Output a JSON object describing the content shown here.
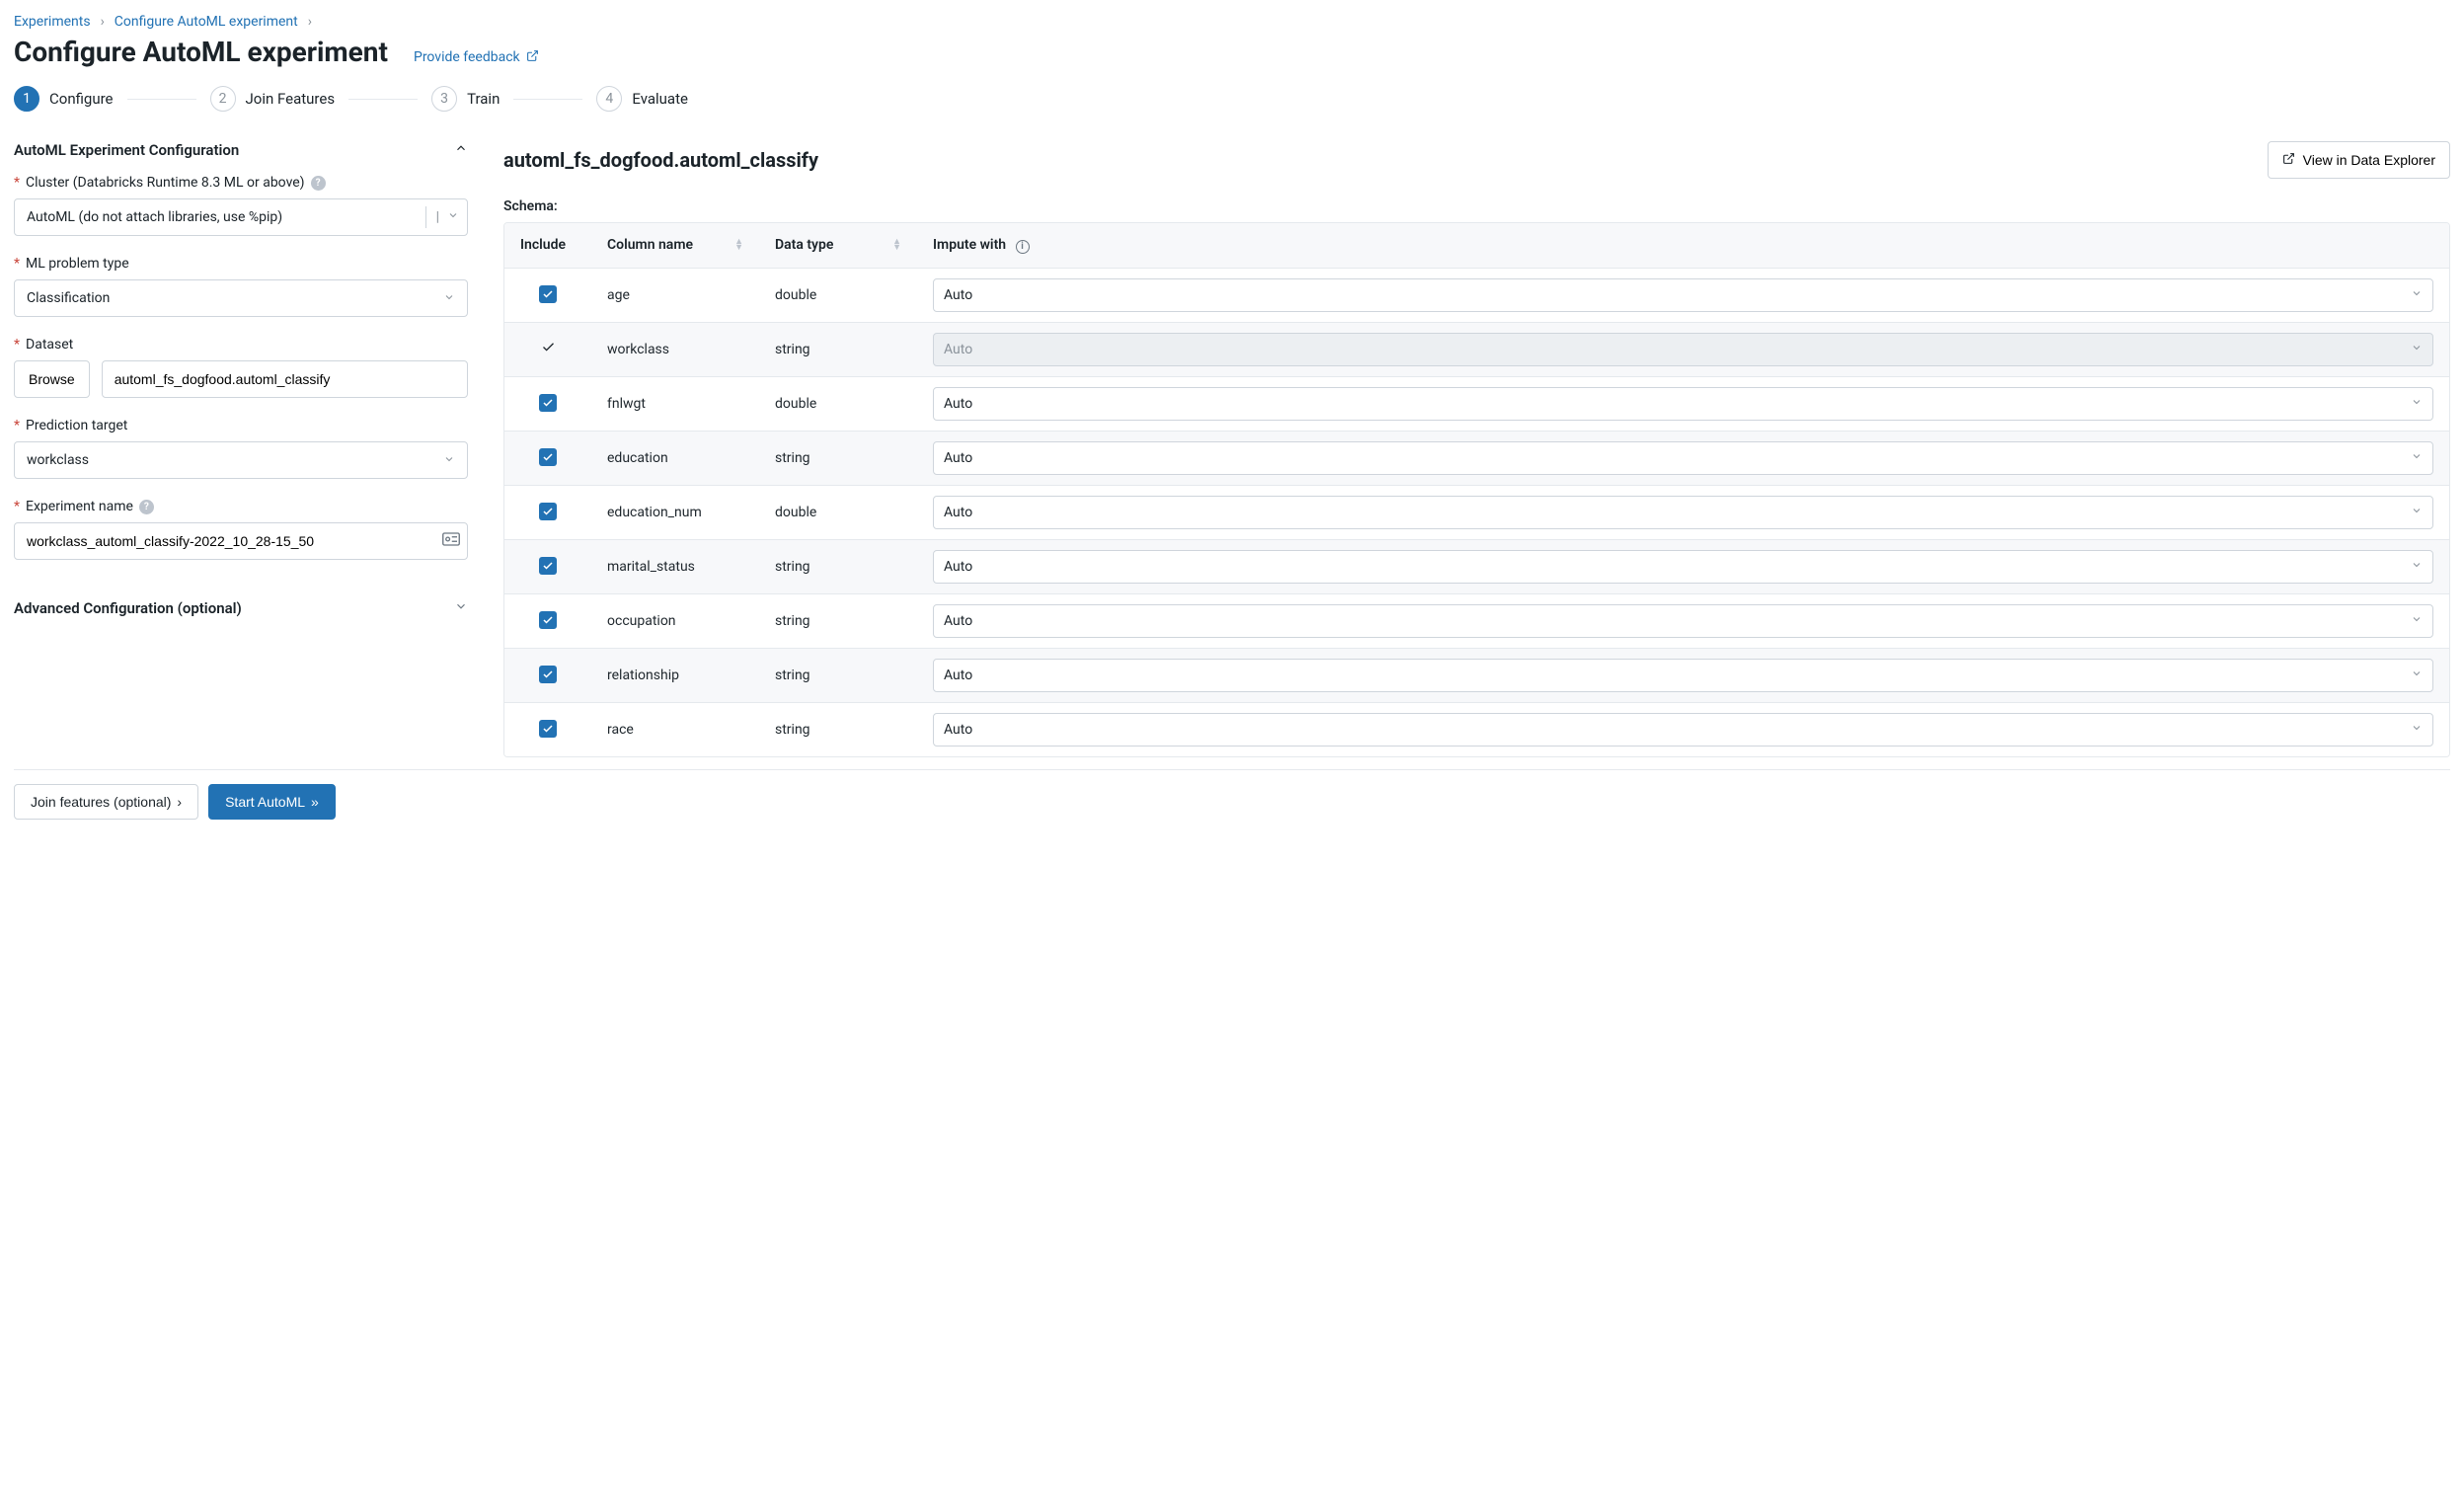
{
  "breadcrumb": {
    "root": "Experiments",
    "current": "Configure AutoML experiment"
  },
  "page_title": "Configure AutoML experiment",
  "feedback_link": "Provide feedback",
  "steps": {
    "s1": "Configure",
    "s2": "Join Features",
    "s3": "Train",
    "s4": "Evaluate"
  },
  "config": {
    "section_title": "AutoML Experiment Configuration",
    "cluster_label": "Cluster (Databricks Runtime 8.3 ML or above)",
    "cluster_value": "AutoML (do not attach libraries, use %pip)",
    "problem_label": "ML problem type",
    "problem_value": "Classification",
    "dataset_label": "Dataset",
    "browse_label": "Browse",
    "dataset_value": "automl_fs_dogfood.automl_classify",
    "target_label": "Prediction target",
    "target_value": "workclass",
    "exp_label": "Experiment name",
    "exp_value": "workclass_automl_classify-2022_10_28-15_50",
    "adv_title": "Advanced Configuration (optional)",
    "auto_option": "Auto"
  },
  "right": {
    "title": "automl_fs_dogfood.automl_classify",
    "explorer_btn": "View in Data Explorer",
    "schema_label": "Schema:"
  },
  "schema_headers": {
    "include": "Include",
    "column": "Column name",
    "type": "Data type",
    "impute": "Impute with"
  },
  "schema_rows": [
    {
      "name": "age",
      "type": "double",
      "included": true,
      "locked": false
    },
    {
      "name": "workclass",
      "type": "string",
      "included": true,
      "locked": true
    },
    {
      "name": "fnlwgt",
      "type": "double",
      "included": true,
      "locked": false
    },
    {
      "name": "education",
      "type": "string",
      "included": true,
      "locked": false
    },
    {
      "name": "education_num",
      "type": "double",
      "included": true,
      "locked": false
    },
    {
      "name": "marital_status",
      "type": "string",
      "included": true,
      "locked": false
    },
    {
      "name": "occupation",
      "type": "string",
      "included": true,
      "locked": false
    },
    {
      "name": "relationship",
      "type": "string",
      "included": true,
      "locked": false
    },
    {
      "name": "race",
      "type": "string",
      "included": true,
      "locked": false
    }
  ],
  "footer": {
    "join_btn": "Join features (optional)",
    "start_btn": "Start AutoML"
  }
}
